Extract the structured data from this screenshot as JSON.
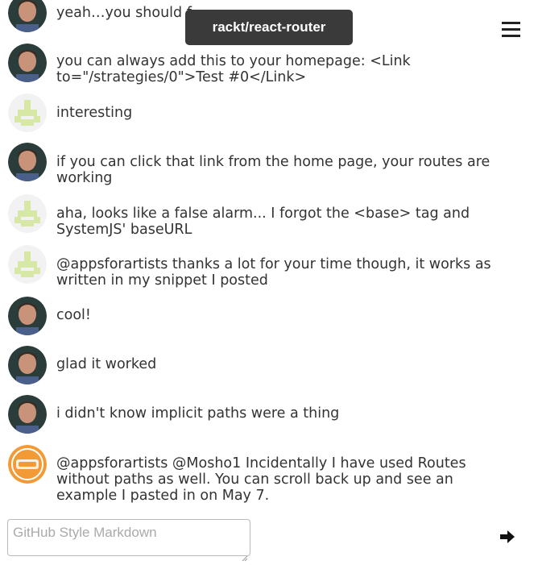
{
  "room": {
    "name": "rackt/react-router"
  },
  "composer": {
    "placeholder": "GitHub Style Markdown"
  },
  "icons": {
    "menu": "hamburger-menu-icon",
    "send": "arrow-right-icon"
  },
  "colors": {
    "pill_bg": "#3a3a3a",
    "identicon": "#d7e8a6",
    "orange_avatar": "#f29a36"
  },
  "messages": [
    {
      "avatar": "photo",
      "text": "yeah…you should f"
    },
    {
      "avatar": "photo",
      "text": "you can always add this to your homepage: <Link to=\"/strategies/0\">Test #0</Link>"
    },
    {
      "avatar": "identicon",
      "text": "interesting"
    },
    {
      "avatar": "photo",
      "text": "if you can click that link from the home page, your routes are working"
    },
    {
      "avatar": "identicon",
      "text": "aha, looks like a false alarm... I forgot the <base> tag and SystemJS' baseURL"
    },
    {
      "avatar": "identicon",
      "text": "@appsforartists thanks a lot for your time though, it works as written in my snippet I posted"
    },
    {
      "avatar": "photo",
      "text": "cool!"
    },
    {
      "avatar": "photo",
      "text": "glad it worked"
    },
    {
      "avatar": "photo",
      "text": "i didn't know implicit paths were a thing"
    },
    {
      "avatar": "orange",
      "text": "@appsforartists @Mosho1 Incidentally I have used Routes without paths as well. You can scroll back up and see an example I pasted in on May 7."
    }
  ]
}
